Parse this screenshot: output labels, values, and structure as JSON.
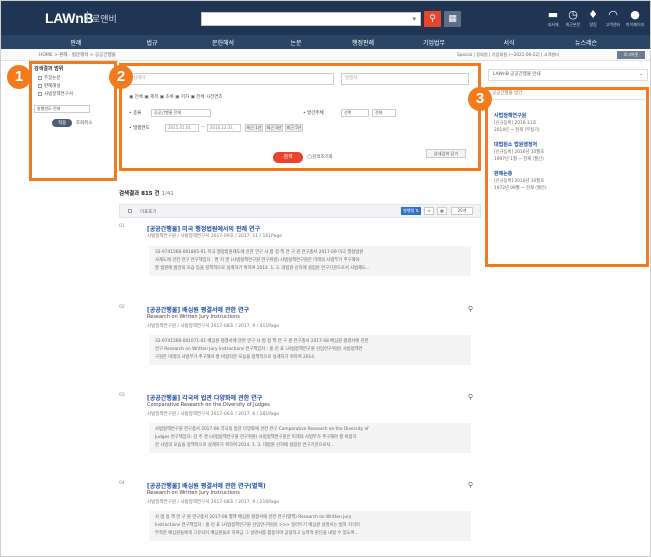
{
  "header": {
    "logo": "LAWnB",
    "logo_sub": "로앤비",
    "search_placeholder": "",
    "icons": [
      {
        "name": "library-icon",
        "label": "내서재",
        "glyph": "▬"
      },
      {
        "name": "recent-icon",
        "label": "최근본문",
        "glyph": "◷"
      },
      {
        "name": "alarm-icon",
        "label": "알림",
        "glyph": "♦"
      },
      {
        "name": "support-icon",
        "label": "고객센터",
        "glyph": "◠"
      },
      {
        "name": "user-icon",
        "label": "마이페이지",
        "glyph": "●"
      }
    ]
  },
  "menu": [
    "판례",
    "법규",
    "문헌해석",
    "논문",
    "행정판례",
    "기업법무",
    "서식",
    "뉴스레슨"
  ],
  "breadcrumb": "HOME > 판례 · 법문해석 > 공공간행물",
  "topright": {
    "text": "Special | 정회원 | 기업회원 (~2021-06-22) | 고객센터",
    "button": "로그아웃"
  },
  "left_panel": {
    "title": "검색결과 범위",
    "items": [
      "주장논문",
      "판례해설",
      "사법정책연구서"
    ],
    "select": "발행연도 전체",
    "apply_button": "적용",
    "reset_link": "조회취소"
  },
  "search_form": {
    "main_placeholder": "검색어",
    "sub_placeholder": "발행처",
    "checkboxes": "▣ 전체  ▣ 제목  ▣ 초록  ▣ 저자  ▣ 전체 사전연조",
    "type_label": "• 종류",
    "type_value": "공공간행물 전체",
    "org_label": "• 발간주체",
    "org_value": "선택",
    "org_value2": "전체",
    "date_label": "• 발행연도",
    "date_from": "2015.01.01",
    "date_to": "2016.12.31",
    "period_buttons": [
      "최근 1년",
      "최근 3년",
      "최근 5년"
    ],
    "detail_button": "상세검색 닫기",
    "search_button": "검색",
    "reset_button": "◯검색조기화"
  },
  "results": {
    "count_label": "검색결과 815 건",
    "page_label": "1/41",
    "toolbar_label": "미표표기",
    "sort_button": "발행일 ⇅",
    "per_page": "20개",
    "items": [
      {
        "num": "01",
        "title": "[공공간행물] 미국 행정법원에서의 판례 연구",
        "en": "",
        "meta": "사법정책연구원 / 사법정책연구서 2017-09호 / 2017. 11 / 161Page",
        "abstract": [
          "32-9741568-001865-01 미국 행정법원제도에 관한 연구 사 법 정 책 연 구 원 연구총서 2017-09 미국 행정법원",
          "사제도에 관한 연구 연구책임자 : 편 지 영 (사법정책연구원 연구위원) 사법정책연구원은 미래의 사법부가 추구해야",
          "할 법원에 법관의 모습 등을 정책적으로 설계하기 위하여 2014. 1. 3. 대법원 산하에 설립된 연구기관으로서 사법제도..."
        ],
        "zoom": false
      },
      {
        "num": "02",
        "title": "[공공간행물] 배심원 평결서에 관한 연구",
        "en": "Research on Written Jury Instructions",
        "meta": "사법정책연구원 / 사법정책연구서 2017-08호 / 2017. 9 / 411Page",
        "abstract": [
          "32-9741568-001071-01 배심원 평결서에 관한 연구 사 법 정 책 연 구 원 연구총서 2017-08 배심원 평결서에 관한",
          "연구 Research on Written Jury Instructions 연구책임자 : 홍 진 표 (사법정책연구원 선임연구위원) 사법정책연",
          "구원은 미래의 사법부가 추구해야 할 바람직한 모습을 정책적으로 설계하기 위하여 2014."
        ],
        "zoom": true
      },
      {
        "num": "03",
        "title": "[공공간행물] 각국의 법관 다양화에 관한 연구",
        "en": "Comparative Research on the Diversity of Judges",
        "meta": "사법정책연구원 / 사법정책연구서 2017-06호 / 2017. 6 / 281Page",
        "abstract": [
          "사법정책연구원 연구총서 2017-06 각국의 법관 다양화에 관한 연구 Comparative Research on the Diversity of",
          "Judges 연구책임자: 김 주 경 (사법정책연구원 연구위원) 사법정책연구원은 미래의 사법부가 추구해야 할 바람직",
          "한 사법의 모습을 정책적으로 설계하기 위하여 2014. 1. 3. 대법원 산하에 설립된 연구기관으로서..."
        ],
        "zoom": true
      },
      {
        "num": "04",
        "title": "[공공간행물] 배심원 평결서에 관한 연구(별책)",
        "en": "Research on Written Jury Instructions",
        "meta": "사법정책연구원 / 사법정책연구서 2017-08호 / 2017. 9 / 216Page",
        "abstract": [
          "사 법 정 책 연 구 원 연구총서 2017-08 별책 배심원 평결서에 관한 연구(별책) Research on Written Jury",
          "Instructions 연구책임자 : 홍 진 표 (사법정책연구원 선임연구위원) >>> 일러두기 배심원 설명서는 법적 지식이",
          "부족한 배심원들에게 고유되어 배심원들로 하여금 그 설명서를 활용하여 공정하고 능력적 판단을 내릴 수 있도록..."
        ],
        "zoom": true
      }
    ]
  },
  "right_panel": {
    "guide": "LAWnB 공공간행물 안내",
    "header": "공공간행물 발간",
    "entries": [
      {
        "name": "사법정책연구원",
        "lines": [
          "[신규등록] 2016-11호",
          "2014년 ~ 현재 (부정기)"
        ]
      },
      {
        "name": "대법원소 법원행정처",
        "lines": [
          "[신규등록] 2016년 10월호",
          "1997년 1월 ~ 현재 (월간)"
        ]
      },
      {
        "name": "판례논총",
        "lines": [
          "[신규등록] 2016년 10월호",
          "1972년 09월 ~ 현재 (월간)"
        ]
      }
    ]
  },
  "badges": [
    "1",
    "2",
    "3"
  ],
  "colors": {
    "header_bg": "#1f3553",
    "menu_bg": "#2b4566",
    "accent": "#e8452c",
    "highlight_border": "#f47a1f",
    "link": "#1f4fa8"
  }
}
